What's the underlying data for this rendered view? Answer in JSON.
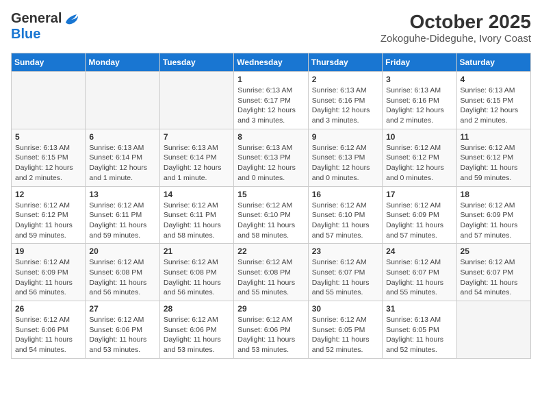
{
  "logo": {
    "general": "General",
    "blue": "Blue"
  },
  "title": "October 2025",
  "subtitle": "Zokoguhe-Dideguhe, Ivory Coast",
  "headers": [
    "Sunday",
    "Monday",
    "Tuesday",
    "Wednesday",
    "Thursday",
    "Friday",
    "Saturday"
  ],
  "weeks": [
    [
      {
        "num": "",
        "detail": ""
      },
      {
        "num": "",
        "detail": ""
      },
      {
        "num": "",
        "detail": ""
      },
      {
        "num": "1",
        "detail": "Sunrise: 6:13 AM\nSunset: 6:17 PM\nDaylight: 12 hours\nand 3 minutes."
      },
      {
        "num": "2",
        "detail": "Sunrise: 6:13 AM\nSunset: 6:16 PM\nDaylight: 12 hours\nand 3 minutes."
      },
      {
        "num": "3",
        "detail": "Sunrise: 6:13 AM\nSunset: 6:16 PM\nDaylight: 12 hours\nand 2 minutes."
      },
      {
        "num": "4",
        "detail": "Sunrise: 6:13 AM\nSunset: 6:15 PM\nDaylight: 12 hours\nand 2 minutes."
      }
    ],
    [
      {
        "num": "5",
        "detail": "Sunrise: 6:13 AM\nSunset: 6:15 PM\nDaylight: 12 hours\nand 2 minutes."
      },
      {
        "num": "6",
        "detail": "Sunrise: 6:13 AM\nSunset: 6:14 PM\nDaylight: 12 hours\nand 1 minute."
      },
      {
        "num": "7",
        "detail": "Sunrise: 6:13 AM\nSunset: 6:14 PM\nDaylight: 12 hours\nand 1 minute."
      },
      {
        "num": "8",
        "detail": "Sunrise: 6:13 AM\nSunset: 6:13 PM\nDaylight: 12 hours\nand 0 minutes."
      },
      {
        "num": "9",
        "detail": "Sunrise: 6:12 AM\nSunset: 6:13 PM\nDaylight: 12 hours\nand 0 minutes."
      },
      {
        "num": "10",
        "detail": "Sunrise: 6:12 AM\nSunset: 6:12 PM\nDaylight: 12 hours\nand 0 minutes."
      },
      {
        "num": "11",
        "detail": "Sunrise: 6:12 AM\nSunset: 6:12 PM\nDaylight: 11 hours\nand 59 minutes."
      }
    ],
    [
      {
        "num": "12",
        "detail": "Sunrise: 6:12 AM\nSunset: 6:12 PM\nDaylight: 11 hours\nand 59 minutes."
      },
      {
        "num": "13",
        "detail": "Sunrise: 6:12 AM\nSunset: 6:11 PM\nDaylight: 11 hours\nand 59 minutes."
      },
      {
        "num": "14",
        "detail": "Sunrise: 6:12 AM\nSunset: 6:11 PM\nDaylight: 11 hours\nand 58 minutes."
      },
      {
        "num": "15",
        "detail": "Sunrise: 6:12 AM\nSunset: 6:10 PM\nDaylight: 11 hours\nand 58 minutes."
      },
      {
        "num": "16",
        "detail": "Sunrise: 6:12 AM\nSunset: 6:10 PM\nDaylight: 11 hours\nand 57 minutes."
      },
      {
        "num": "17",
        "detail": "Sunrise: 6:12 AM\nSunset: 6:09 PM\nDaylight: 11 hours\nand 57 minutes."
      },
      {
        "num": "18",
        "detail": "Sunrise: 6:12 AM\nSunset: 6:09 PM\nDaylight: 11 hours\nand 57 minutes."
      }
    ],
    [
      {
        "num": "19",
        "detail": "Sunrise: 6:12 AM\nSunset: 6:09 PM\nDaylight: 11 hours\nand 56 minutes."
      },
      {
        "num": "20",
        "detail": "Sunrise: 6:12 AM\nSunset: 6:08 PM\nDaylight: 11 hours\nand 56 minutes."
      },
      {
        "num": "21",
        "detail": "Sunrise: 6:12 AM\nSunset: 6:08 PM\nDaylight: 11 hours\nand 56 minutes."
      },
      {
        "num": "22",
        "detail": "Sunrise: 6:12 AM\nSunset: 6:08 PM\nDaylight: 11 hours\nand 55 minutes."
      },
      {
        "num": "23",
        "detail": "Sunrise: 6:12 AM\nSunset: 6:07 PM\nDaylight: 11 hours\nand 55 minutes."
      },
      {
        "num": "24",
        "detail": "Sunrise: 6:12 AM\nSunset: 6:07 PM\nDaylight: 11 hours\nand 55 minutes."
      },
      {
        "num": "25",
        "detail": "Sunrise: 6:12 AM\nSunset: 6:07 PM\nDaylight: 11 hours\nand 54 minutes."
      }
    ],
    [
      {
        "num": "26",
        "detail": "Sunrise: 6:12 AM\nSunset: 6:06 PM\nDaylight: 11 hours\nand 54 minutes."
      },
      {
        "num": "27",
        "detail": "Sunrise: 6:12 AM\nSunset: 6:06 PM\nDaylight: 11 hours\nand 53 minutes."
      },
      {
        "num": "28",
        "detail": "Sunrise: 6:12 AM\nSunset: 6:06 PM\nDaylight: 11 hours\nand 53 minutes."
      },
      {
        "num": "29",
        "detail": "Sunrise: 6:12 AM\nSunset: 6:06 PM\nDaylight: 11 hours\nand 53 minutes."
      },
      {
        "num": "30",
        "detail": "Sunrise: 6:12 AM\nSunset: 6:05 PM\nDaylight: 11 hours\nand 52 minutes."
      },
      {
        "num": "31",
        "detail": "Sunrise: 6:13 AM\nSunset: 6:05 PM\nDaylight: 11 hours\nand 52 minutes."
      },
      {
        "num": "",
        "detail": ""
      }
    ]
  ]
}
